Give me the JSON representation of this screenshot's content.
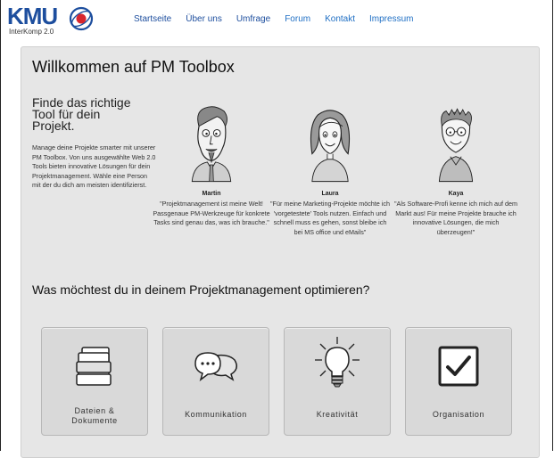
{
  "header": {
    "logo_text": "KMU",
    "logo_subtext": "InterKomp 2.0",
    "nav": [
      {
        "label": "Startseite"
      },
      {
        "label": "Über uns"
      },
      {
        "label": "Umfrage"
      },
      {
        "label": "Forum"
      },
      {
        "label": "Kontakt"
      },
      {
        "label": "Impressum"
      }
    ],
    "active_nav_color": "#1f6fc4",
    "nav_color": "#1d4e9e"
  },
  "main": {
    "title": "Willkommen auf PM Toolbox",
    "subtitle": "Finde das richtige Tool für dein Projekt.",
    "intro": "Manage deine Projekte smarter mit unserer PM Toolbox. Von uns ausgewählte Web 2.0 Tools bieten innovative Lösungen für dein Projektmanagement. Wähle eine Person mit der du dich am meisten identifizierst.",
    "personas": [
      {
        "name": "Martin",
        "quote": "\"Projektmanagement ist meine Welt! Passgenaue PM-Werkzeuge für konkrete Tasks sind genau das, was ich brauche.\"",
        "icon": "martin-avatar-icon"
      },
      {
        "name": "Laura",
        "quote": "\"Für meine Marketing-Projekte möchte ich 'vorgetestete' Tools nutzen. Einfach und schnell muss es gehen, sonst bleibe ich bei MS office und eMails\"",
        "icon": "laura-avatar-icon"
      },
      {
        "name": "Kaya",
        "quote": "\"Als Software-Profi kenne ich mich auf dem Markt aus! Für meine Projekte brauche ich innovative Lösungen, die mich überzeugen!\"",
        "icon": "kaya-avatar-icon"
      }
    ],
    "question": "Was möchtest du in deinem Projektmanagement optimieren?",
    "categories": [
      {
        "label": "Dateien &\nDokumente",
        "icon": "documents-icon"
      },
      {
        "label": "Kommunikation",
        "icon": "speech-bubbles-icon"
      },
      {
        "label": "Kreativität",
        "icon": "lightbulb-icon"
      },
      {
        "label": "Organisation",
        "icon": "checkbox-icon"
      }
    ]
  }
}
